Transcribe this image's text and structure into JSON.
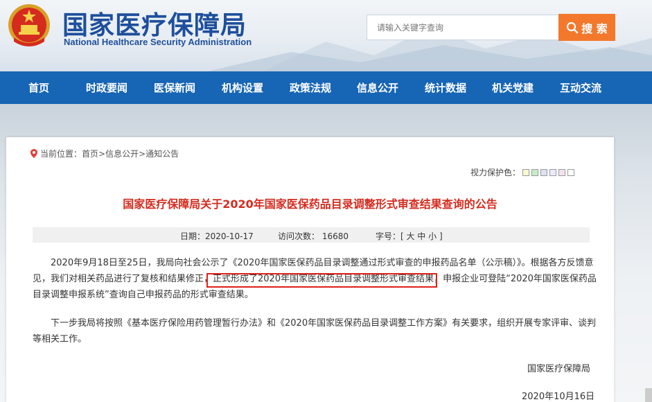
{
  "header": {
    "title_cn": "国家医疗保障局",
    "title_en": "National Healthcare Security Administration",
    "search_placeholder": "请输入关键字查询",
    "search_button": "搜 索",
    "emblem_icon": "national-emblem-icon"
  },
  "nav": {
    "items": [
      "首页",
      "时政要闻",
      "医保新闻",
      "机构设置",
      "政策法规",
      "信息公开",
      "统计数据",
      "机关党建",
      "互动交流"
    ]
  },
  "breadcrumb": {
    "prefix": "当前位置：",
    "items": [
      "首页",
      "信息公开",
      "通知公告"
    ],
    "separator": ">"
  },
  "vision": {
    "label": "视力保护色：",
    "colors": [
      "#fafad2",
      "#c7edcc",
      "#dce2f1",
      "#e9ebfe",
      "#f3e1f2",
      "#ffffff"
    ]
  },
  "article": {
    "title": "国家医疗保障局关于2020年国家医保药品目录调整形式审查结果查询的公告",
    "date": "日期：2020-10-17",
    "visits": "访问次数： 16680",
    "font_size": "字号：[ 大 中 小 ]",
    "para1_line1": "2020年9月18日至25日，我局向社会公示了《2020年国家医保药品目录调整通过形式审查的申报药品名单（公示稿）》。根据各方反馈意",
    "para1_line2a": "见，我们对相关药品进行了复核和结果修正，",
    "para1_line2b": "正式形成了2020年国家医保药品目录调整形式审查结果，",
    "para1_line2c": "申报企业可登陆“2020年国家医保药品",
    "para1_line3": "目录调整申报系统”查询自己申报药品的形式审查结果。",
    "para2_line1": "下一步我局将按照《基本医疗保险用药管理暂行办法》和《2020年国家医保药品目录调整工作方案》有关要求，组织开展专家评审、谈判",
    "para2_line2": "等相关工作。",
    "signature": "国家医疗保障局",
    "sign_date": "2020年10月16日"
  },
  "colors": {
    "brand_blue": "#1765b5",
    "title_red": "#d52b1e",
    "search_orange": "#f3782c"
  }
}
